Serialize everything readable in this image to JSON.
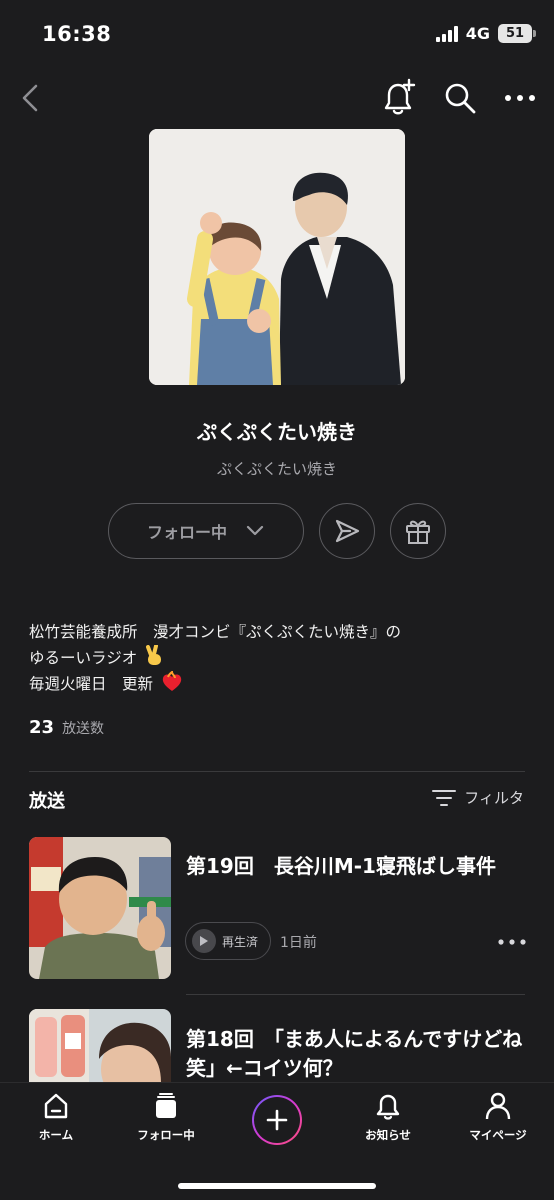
{
  "status_bar": {
    "time": "16:38",
    "network": "4G",
    "battery": "51"
  },
  "nav": {
    "back_icon": "chevron-left-icon",
    "bell_icon": "bell-plus-icon",
    "search_icon": "search-icon",
    "more_icon": "more-horizontal-icon"
  },
  "channel": {
    "title": "ぷくぷくたい焼き",
    "subtitle": "ぷくぷくたい焼き",
    "follow_label": "フォロー中",
    "description_lines": [
      "松竹芸能養成所　漫才コンビ『ぷくぷくたい焼き』の",
      "ゆるーいラジオ",
      "毎週火曜日　更新"
    ],
    "episode_count": "23",
    "episode_count_label": "放送数"
  },
  "section": {
    "title": "放送",
    "filter_label": "フィルタ"
  },
  "episodes": [
    {
      "title": "第19回　長谷川M-1寝飛ばし事件",
      "status": "再生済",
      "date": "1日前"
    },
    {
      "title": "第18回　「まあ人によるんですけどね笑」←コイツ何？"
    }
  ],
  "tab_bar": {
    "items": [
      {
        "label": "ホーム",
        "icon": "home-icon"
      },
      {
        "label": "フォロー中",
        "icon": "library-icon"
      },
      {
        "label": "",
        "icon": "plus-icon"
      },
      {
        "label": "お知らせ",
        "icon": "bell-icon"
      },
      {
        "label": "マイページ",
        "icon": "person-icon"
      }
    ]
  },
  "colors": {
    "background": "#1c1c1e",
    "text": "#ffffff",
    "muted": "#a9a9ae",
    "create_gradient": [
      "#6a5cff",
      "#d63ad0",
      "#ff4f7a"
    ]
  }
}
